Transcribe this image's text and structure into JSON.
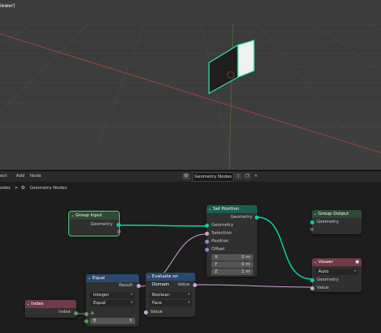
{
  "viewport": {
    "title": "iewer)"
  },
  "header": {
    "menu": [
      "ect",
      "Add",
      "Node"
    ],
    "tree_name": "Geometry Nodes",
    "colors": {
      "bg": "#2a2a2a"
    }
  },
  "breadcrumb": {
    "parent": "odes",
    "sep": ">",
    "current": "Geometry Nodes"
  },
  "nodes": {
    "group_input": {
      "title": "Group Input",
      "geometry": "Geometry"
    },
    "group_output": {
      "title": "Group Output",
      "geometry": "Geometry"
    },
    "set_position": {
      "title": "Set Position",
      "out_geometry": "Geometry",
      "in_geometry": "Geometry",
      "selection": "Selection",
      "position": "Position",
      "offset": "Offset",
      "x_label": "X",
      "x_value": "0 m",
      "y_label": "Y",
      "y_value": "0 m",
      "z_label": "Z",
      "z_value": "1 m"
    },
    "viewer": {
      "title": "Viewer",
      "domain": "Auto",
      "geometry": "Geometry",
      "value": "Value"
    },
    "equal": {
      "title": "Equal",
      "result": "Result",
      "data_type": "Integer",
      "operation": "Equal",
      "a": "A",
      "b_label": "B",
      "b_value": "3"
    },
    "evaluate": {
      "title": "Evaluate on Domain",
      "value_out": "Value",
      "type": "Boolean",
      "domain": "Face",
      "value_in": "Value"
    },
    "index": {
      "title": "Index",
      "index": "Index"
    }
  },
  "colors": {
    "input_header": "#1f3d2b",
    "geometry_header": "#1b5e4f",
    "utility_header": "#2b4a6b",
    "output_header": "#713a46",
    "geometry_link": "#00d6a3",
    "field_link": "#8c8cd6"
  }
}
